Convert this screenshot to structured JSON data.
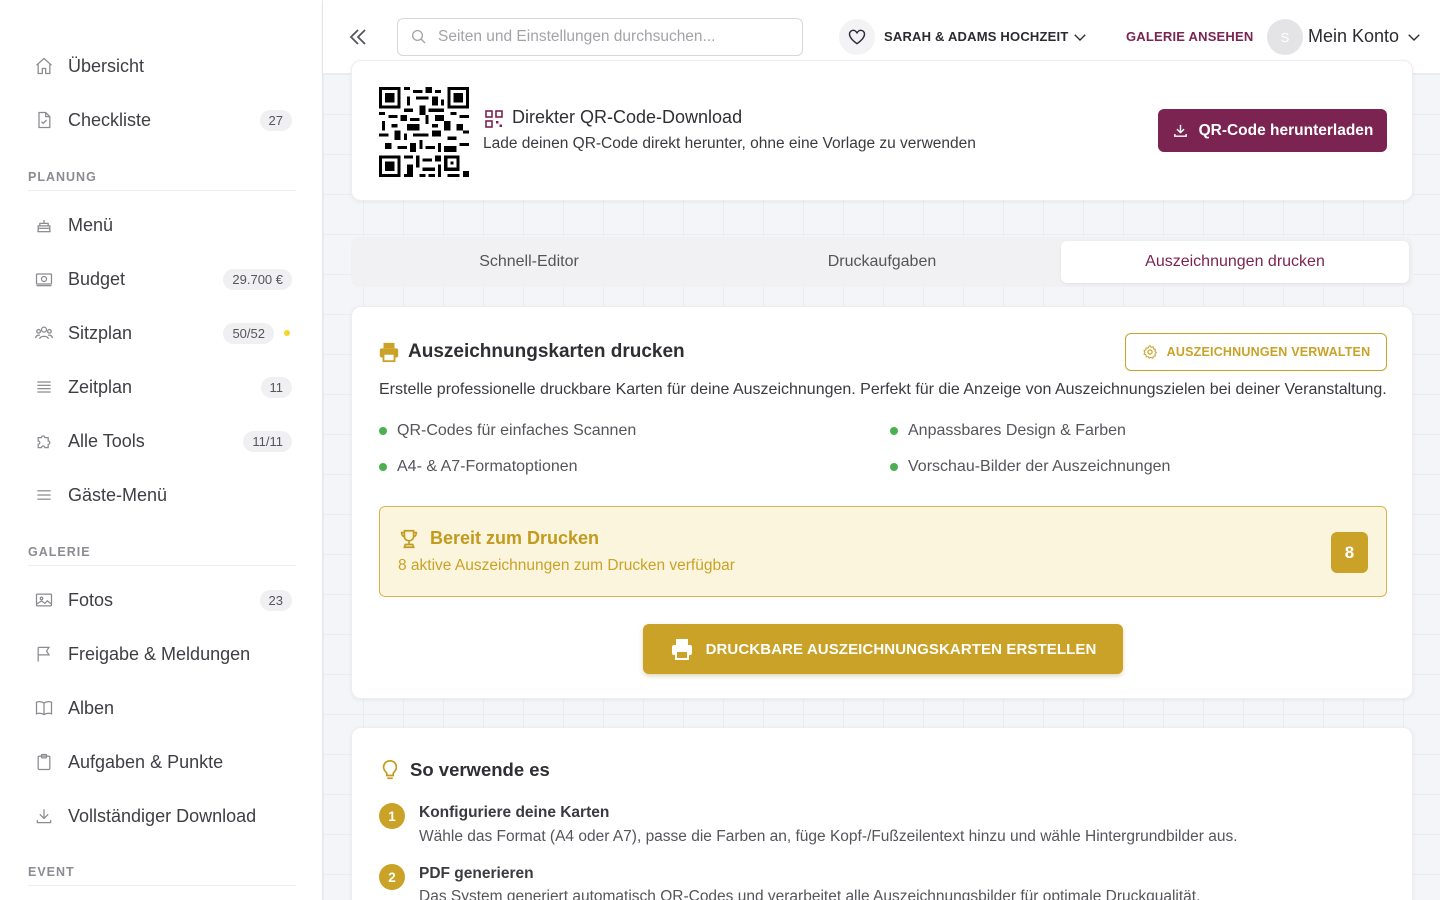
{
  "sidebar": {
    "items": [
      {
        "label": "Übersicht",
        "badge": null
      },
      {
        "label": "Checkliste",
        "badge": "27"
      },
      {
        "label": "Menü",
        "badge": null
      },
      {
        "label": "Budget",
        "badge": "29.700 €"
      },
      {
        "label": "Sitzplan",
        "badge": "50/52"
      },
      {
        "label": "Zeitplan",
        "badge": "11"
      },
      {
        "label": "Alle Tools",
        "badge": "11/11"
      },
      {
        "label": "Gäste-Menü",
        "badge": null
      },
      {
        "label": "Fotos",
        "badge": "23"
      },
      {
        "label": "Freigabe & Meldungen",
        "badge": null
      },
      {
        "label": "Alben",
        "badge": null
      },
      {
        "label": "Aufgaben & Punkte",
        "badge": null
      },
      {
        "label": "Vollständiger Download",
        "badge": null
      }
    ],
    "sections": {
      "planung": "PLANUNG",
      "galerie": "GALERIE",
      "event": "EVENT"
    }
  },
  "header": {
    "search_placeholder": "Seiten und Einstellungen durchsuchen...",
    "event_name": "SARAH & ADAMS HOCHZEIT",
    "gallery_link": "GALERIE ANSEHEN",
    "avatar_initial": "S",
    "account_label": "Mein Konto"
  },
  "qr": {
    "title": "Direkter QR-Code-Download",
    "description": "Lade deinen QR-Code direkt herunter, ohne eine Vorlage zu verwenden",
    "download_button": "QR-Code herunterladen"
  },
  "tabs": [
    {
      "label": "Schnell-Editor",
      "active": false
    },
    {
      "label": "Druckaufgaben",
      "active": false
    },
    {
      "label": "Auszeichnungen drucken",
      "active": true
    }
  ],
  "awards": {
    "title": "Auszeichnungskarten drucken",
    "manage_button": "AUSZEICHNUNGEN VERWALTEN",
    "description": "Erstelle professionelle druckbare Karten für deine Auszeichnungen. Perfekt für die Anzeige von Auszeichnungszielen bei deiner Veranstaltung.",
    "features": [
      "QR-Codes für einfaches Scannen",
      "Anpassbares Design & Farben",
      "A4- & A7-Formatoptionen",
      "Vorschau-Bilder der Auszeichnungen"
    ],
    "ready_title": "Bereit zum Drucken",
    "ready_subtitle": "8 aktive Auszeichnungen zum Drucken verfügbar",
    "ready_count": "8",
    "create_button": "DRUCKBARE AUSZEICHNUNGSKARTEN ERSTELLEN"
  },
  "howto": {
    "title": "So verwende es",
    "steps": [
      {
        "num": "1",
        "title": "Konfiguriere deine Karten",
        "desc": "Wähle das Format (A4 oder A7), passe die Farben an, füge Kopf-/Fußzeilentext hinzu und wähle Hintergrundbilder aus."
      },
      {
        "num": "2",
        "title": "PDF generieren",
        "desc": "Das System generiert automatisch QR-Codes und verarbeitet alle Auszeichnungsbilder für optimale Druckqualität."
      }
    ]
  },
  "colors": {
    "brand": "#7c2451",
    "gold": "#c9a227",
    "feature_dot": "#4caf50",
    "status_dot": "#f5d52b"
  }
}
